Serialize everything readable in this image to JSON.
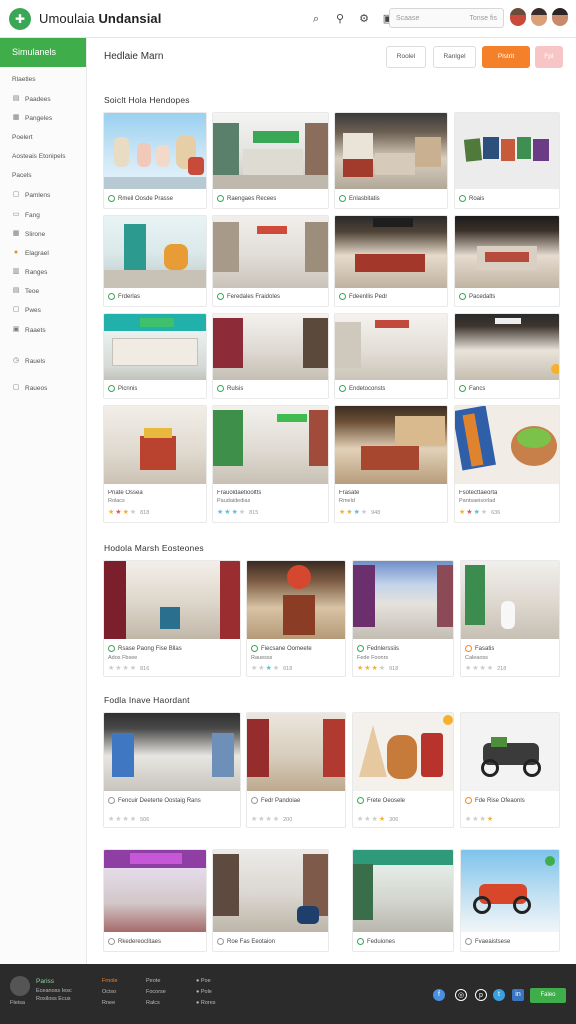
{
  "header": {
    "app_title_light": "Umoulaia",
    "app_title_bold": "Undansial",
    "search_placeholder": "Scaase",
    "search_hint": "Tonse fis",
    "icons": [
      "search-icon",
      "search-alt-icon",
      "settings-icon",
      "grid-icon"
    ]
  },
  "sidebar": {
    "heading": "Simulanels",
    "items": [
      {
        "label": "Rlaetles"
      },
      {
        "label": "Paadees"
      },
      {
        "label": "Pangeles"
      },
      {
        "label": "Poelert"
      },
      {
        "label": "Aosteais Etonipels"
      },
      {
        "label": "Pacels"
      },
      {
        "label": "Pamlens"
      },
      {
        "label": "Fang"
      },
      {
        "label": "Slirone"
      },
      {
        "label": "Elagrael"
      },
      {
        "label": "Ranges"
      },
      {
        "label": "Teoe"
      },
      {
        "label": "Pwes"
      },
      {
        "label": "Raaets"
      },
      {
        "label": "Rauels"
      },
      {
        "label": "Raueos"
      }
    ]
  },
  "page": {
    "title": "Hedlaie Marn",
    "buttons": [
      "Roolel",
      "Ranlgel",
      "Plstrit",
      "Fpt"
    ]
  },
  "sections": [
    {
      "title": "Soiclt Hola Hendopes"
    },
    {
      "title": "Hodola Marsh Eosteones"
    },
    {
      "title": "Fodla Inave Haordant"
    }
  ],
  "cards": [
    {
      "caption": "Rmeil Oosde Prasse",
      "sub": "",
      "rating": ""
    },
    {
      "caption": "Raengaes Recees",
      "sub": "",
      "rating": ""
    },
    {
      "caption": "Enlasbitatis",
      "sub": "",
      "rating": ""
    },
    {
      "caption": "Roais",
      "sub": "",
      "rating": ""
    },
    {
      "caption": "Frderlas",
      "sub": "",
      "rating": ""
    },
    {
      "caption": "Feredales Fraidoles",
      "sub": "",
      "rating": ""
    },
    {
      "caption": "Fdeenllis Pedr",
      "sub": "",
      "rating": ""
    },
    {
      "caption": "Pacedalts",
      "sub": "",
      "rating": ""
    },
    {
      "caption": "Picnnis",
      "sub": "",
      "rating": ""
    },
    {
      "caption": "Rulsis",
      "sub": "",
      "rating": ""
    },
    {
      "caption": "Endetoconsts",
      "sub": "",
      "rating": ""
    },
    {
      "caption": "Fancs",
      "sub": "",
      "rating": ""
    },
    {
      "caption": "Priate Ossea",
      "sub": "Rolacs",
      "rating": "818"
    },
    {
      "caption": "Frauoldaetiooltts",
      "sub": "Paudaidedias",
      "rating": "815"
    },
    {
      "caption": "Frasate",
      "sub": "Rmeld",
      "rating": "948"
    },
    {
      "caption": "Fsotecttaeorta",
      "sub": "Pantsaeisorlad",
      "rating": "636"
    },
    {
      "caption": "Rsase Paong Fise Bllas",
      "sub": "Ados Fbsee",
      "rating": "816"
    },
    {
      "caption": "Fiecsane Oomeete",
      "sub": "Rauesss",
      "rating": "618"
    },
    {
      "caption": "Fednlerssiis",
      "sub": "Fede Foonrs",
      "rating": "918"
    },
    {
      "caption": "Fasatis",
      "sub": "Caleaoss",
      "rating": "218"
    },
    {
      "caption": "Fencuir Deeterte Oostaig Rans",
      "sub": "",
      "rating": "506"
    },
    {
      "caption": "Fedr Pandoiae",
      "sub": "",
      "rating": "200"
    },
    {
      "caption": "Frete Oeosele",
      "sub": "",
      "rating": "306"
    },
    {
      "caption": "Fde Rise Ofeaonls",
      "sub": "",
      "rating": ""
    },
    {
      "caption": "Rkedereoclitaes",
      "sub": "",
      "rating": ""
    },
    {
      "caption": "Roe Fas Eeotaion",
      "sub": "",
      "rating": ""
    },
    {
      "caption": "Feduiones",
      "sub": "",
      "rating": ""
    },
    {
      "caption": "Fvaeaistsese",
      "sub": "",
      "rating": ""
    }
  ],
  "footer": {
    "brand": "Pariss",
    "lines": [
      "Eceanoss Iesc",
      "Rosiloss Ecus"
    ],
    "small_label": "Fteisa",
    "col1": [
      "Frnole",
      "Ociso",
      "Rnee"
    ],
    "col2": [
      "Peote",
      "Focorse",
      "Ralcs"
    ],
    "col3": [
      "Poe",
      "Pole",
      "Rores"
    ],
    "cta": "Faleo"
  },
  "colors": {
    "accent": "#3fae4a",
    "orange": "#f4802a",
    "pink": "#f8c5c7",
    "footer": "#2b2b2b"
  }
}
